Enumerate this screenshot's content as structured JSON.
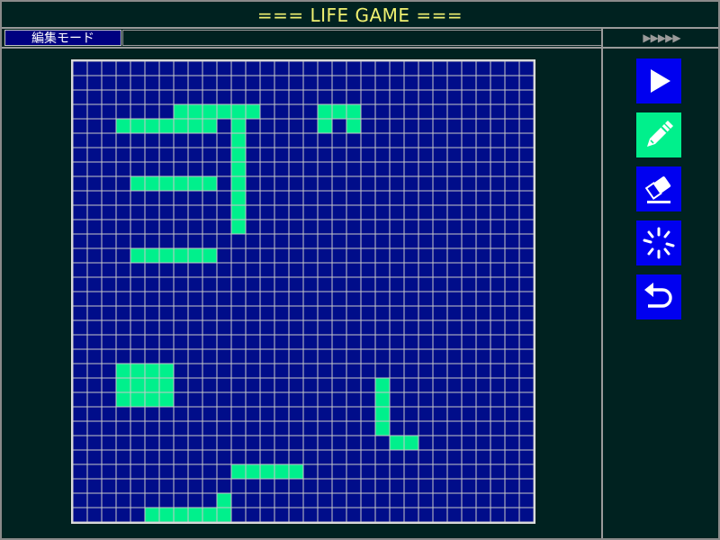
{
  "app": {
    "title": "=== LIFE GAME ==="
  },
  "status": {
    "mode_label": "編集モード",
    "speed_arrows": "▶▶▶▶▶"
  },
  "toolbar": {
    "buttons": [
      {
        "name": "play-button",
        "icon": "play-icon",
        "active": false
      },
      {
        "name": "pen-button",
        "icon": "pencil-icon",
        "active": true
      },
      {
        "name": "eraser-button",
        "icon": "eraser-icon",
        "active": false
      },
      {
        "name": "clear-button",
        "icon": "burst-icon",
        "active": false
      },
      {
        "name": "undo-button",
        "icon": "undo-icon",
        "active": false
      }
    ]
  },
  "colors": {
    "dead_cell": "#000d8a",
    "live_cell": "#00f08c",
    "grid_line": "#c8c8c8",
    "button_bg": "#0000f0",
    "button_active_bg": "#00f08c"
  },
  "grid": {
    "cols": 32,
    "rows": 32,
    "live_cells": [
      [
        3,
        4
      ],
      [
        4,
        4
      ],
      [
        5,
        4
      ],
      [
        6,
        4
      ],
      [
        7,
        4
      ],
      [
        8,
        4
      ],
      [
        9,
        4
      ],
      [
        4,
        8
      ],
      [
        5,
        8
      ],
      [
        6,
        8
      ],
      [
        7,
        8
      ],
      [
        8,
        8
      ],
      [
        9,
        8
      ],
      [
        7,
        3
      ],
      [
        8,
        3
      ],
      [
        9,
        3
      ],
      [
        10,
        3
      ],
      [
        11,
        3
      ],
      [
        12,
        3
      ],
      [
        11,
        4
      ],
      [
        11,
        5
      ],
      [
        11,
        6
      ],
      [
        11,
        7
      ],
      [
        11,
        8
      ],
      [
        11,
        9
      ],
      [
        11,
        10
      ],
      [
        11,
        11
      ],
      [
        4,
        13
      ],
      [
        5,
        13
      ],
      [
        6,
        13
      ],
      [
        7,
        13
      ],
      [
        8,
        13
      ],
      [
        9,
        13
      ],
      [
        4,
        21
      ],
      [
        4,
        22
      ],
      [
        4,
        23
      ],
      [
        5,
        21
      ],
      [
        5,
        22
      ],
      [
        5,
        23
      ],
      [
        21,
        22
      ],
      [
        21,
        23
      ],
      [
        21,
        24
      ],
      [
        21,
        25
      ],
      [
        22,
        26
      ],
      [
        23,
        26
      ],
      [
        5,
        31
      ],
      [
        6,
        31
      ],
      [
        7,
        31
      ],
      [
        8,
        31
      ],
      [
        9,
        31
      ],
      [
        10,
        31
      ],
      [
        10,
        30
      ],
      [
        11,
        28
      ],
      [
        12,
        28
      ],
      [
        13,
        28
      ],
      [
        14,
        28
      ],
      [
        15,
        28
      ],
      [
        3,
        21
      ],
      [
        6,
        21
      ],
      [
        3,
        22
      ],
      [
        6,
        22
      ],
      [
        3,
        23
      ],
      [
        6,
        23
      ],
      [
        17,
        3
      ],
      [
        18,
        3
      ],
      [
        19,
        3
      ],
      [
        17,
        4
      ],
      [
        19,
        4
      ]
    ]
  }
}
